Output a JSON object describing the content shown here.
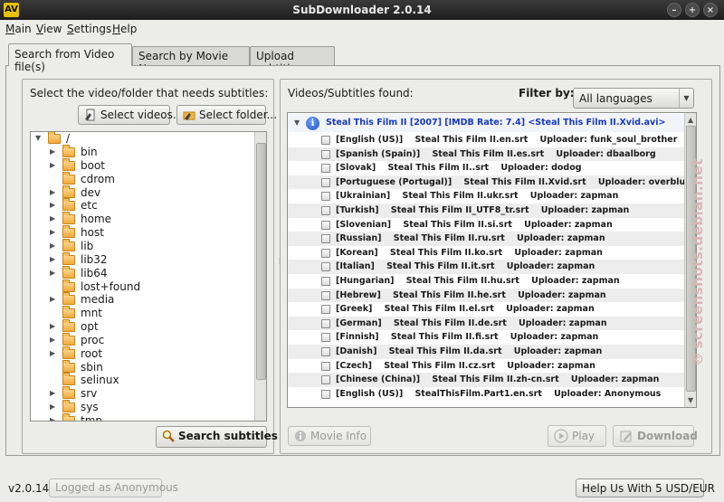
{
  "window": {
    "title": "SubDownloader 2.0.14",
    "app_icon": "AV",
    "controls": {
      "minimize": "–",
      "maximize": "+",
      "close": "×"
    }
  },
  "menu": [
    "Main",
    "View",
    "Settings",
    "Help"
  ],
  "tabs": [
    {
      "label": "Search from Video file(s)",
      "active": true
    },
    {
      "label": "Search by Movie Name",
      "active": false
    },
    {
      "label": "Upload subtitles",
      "active": false
    }
  ],
  "left_panel": {
    "instruction": "Select the video/folder that needs subtitles:",
    "select_videos_label": "Select videos...",
    "select_folder_label": "Select folder...",
    "tree": {
      "root": "/",
      "items": [
        {
          "name": "bin",
          "expandable": true
        },
        {
          "name": "boot",
          "expandable": true
        },
        {
          "name": "cdrom",
          "expandable": false
        },
        {
          "name": "dev",
          "expandable": true
        },
        {
          "name": "etc",
          "expandable": true
        },
        {
          "name": "home",
          "expandable": true
        },
        {
          "name": "host",
          "expandable": true
        },
        {
          "name": "lib",
          "expandable": true
        },
        {
          "name": "lib32",
          "expandable": true
        },
        {
          "name": "lib64",
          "expandable": true
        },
        {
          "name": "lost+found",
          "expandable": false
        },
        {
          "name": "media",
          "expandable": true
        },
        {
          "name": "mnt",
          "expandable": false
        },
        {
          "name": "opt",
          "expandable": true
        },
        {
          "name": "proc",
          "expandable": true
        },
        {
          "name": "root",
          "expandable": true
        },
        {
          "name": "sbin",
          "expandable": false
        },
        {
          "name": "selinux",
          "expandable": false
        },
        {
          "name": "srv",
          "expandable": true
        },
        {
          "name": "sys",
          "expandable": true
        },
        {
          "name": "tmp",
          "expandable": true
        }
      ]
    },
    "search_button_label": "Search subtitles"
  },
  "right_panel": {
    "title": "Videos/Subtitles found:",
    "filter_label": "Filter by:",
    "filter_value": "All languages",
    "video_header": "Steal This Film II [2007] [IMDB Rate: 7.4] <Steal This Film II.Xvid.avi>",
    "subtitles": [
      "[English (US)]    Steal This Film II.en.srt    Uploader: funk_soul_brother",
      "[Spanish (Spain)]    Steal This Film II.es.srt    Uploader: dbaalborg",
      "[Slovak]    Steal This Film II..srt    Uploader: dodog",
      "[Portuguese (Portugal)]    Steal This Film II.Xvid.srt    Uploader: overblue",
      "[Ukrainian]    Steal This Film II.ukr.srt    Uploader: zapman",
      "[Turkish]    Steal This Film II_UTF8_tr.srt    Uploader: zapman",
      "[Slovenian]    Steal This Film II.si.srt    Uploader: zapman",
      "[Russian]    Steal This Film II.ru.srt    Uploader: zapman",
      "[Korean]    Steal This Film II.ko.srt    Uploader: zapman",
      "[Italian]    Steal This Film II.it.srt    Uploader: zapman",
      "[Hungarian]    Steal This Film II.hu.srt    Uploader: zapman",
      "[Hebrew]    Steal This Film II.he.srt    Uploader: zapman",
      "[Greek]    Steal This Film II.el.srt    Uploader: zapman",
      "[German]    Steal This Film II.de.srt    Uploader: zapman",
      "[Finnish]    Steal This Film II.fi.srt    Uploader: zapman",
      "[Danish]    Steal This Film II.da.srt    Uploader: zapman",
      "[Czech]    Steal This Film II.cz.srt    Uploader: zapman",
      "[Chinese (China)]    Steal This Film II.zh-cn.srt    Uploader: zapman",
      "[English (US)]    StealThisFilm.Part1.en.srt    Uploader: Anonymous"
    ],
    "movie_info_label": "Movie Info",
    "play_label": "Play",
    "download_label": "Download"
  },
  "status": {
    "version": "v2.0.14",
    "login": "Logged as Anonymous",
    "help_button": "Help Us With 5 USD/EUR"
  },
  "watermark": "screenshots.debian.net"
}
